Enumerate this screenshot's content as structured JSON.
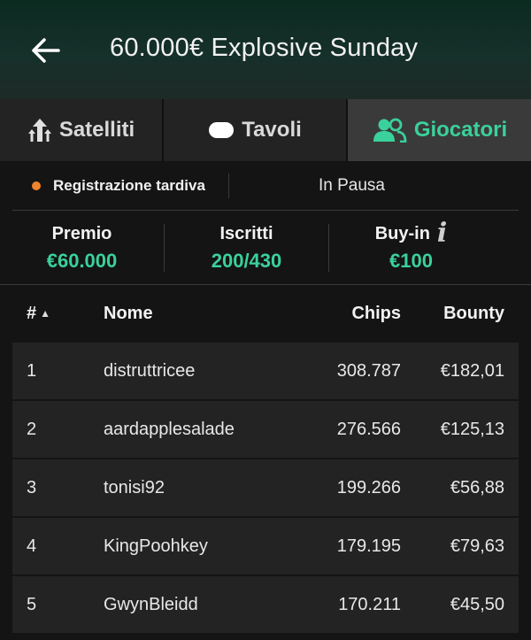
{
  "header": {
    "title": "60.000€ Explosive Sunday"
  },
  "tabs": [
    {
      "label": "Satelliti",
      "icon": "satellite-arrows-icon"
    },
    {
      "label": "Tavoli",
      "icon": "table-icon"
    },
    {
      "label": "Giocatori",
      "icon": "players-icon",
      "active": true
    }
  ],
  "status": {
    "registration_label": "Registrazione tardiva",
    "state": "In Pausa",
    "dot_color": "#f0842c"
  },
  "stats": {
    "prize_label": "Premio",
    "prize_value": "€60.000",
    "entrants_label": "Iscritti",
    "entrants_value": "200/430",
    "buyin_label": "Buy-in",
    "buyin_value": "€100"
  },
  "table": {
    "headers": {
      "rank": "#",
      "name": "Nome",
      "chips": "Chips",
      "bounty": "Bounty"
    },
    "rows": [
      {
        "rank": "1",
        "name": "distruttricee",
        "chips": "308.787",
        "bounty": "€182,01"
      },
      {
        "rank": "2",
        "name": "aardapplesalade",
        "chips": "276.566",
        "bounty": "€125,13"
      },
      {
        "rank": "3",
        "name": "tonisi92",
        "chips": "199.266",
        "bounty": "€56,88"
      },
      {
        "rank": "4",
        "name": "KingPoohkey",
        "chips": "179.195",
        "bounty": "€79,63"
      },
      {
        "rank": "5",
        "name": "GwynBleidd",
        "chips": "170.211",
        "bounty": "€45,50"
      }
    ]
  },
  "colors": {
    "accent": "#3ad19c",
    "background": "#141414"
  }
}
